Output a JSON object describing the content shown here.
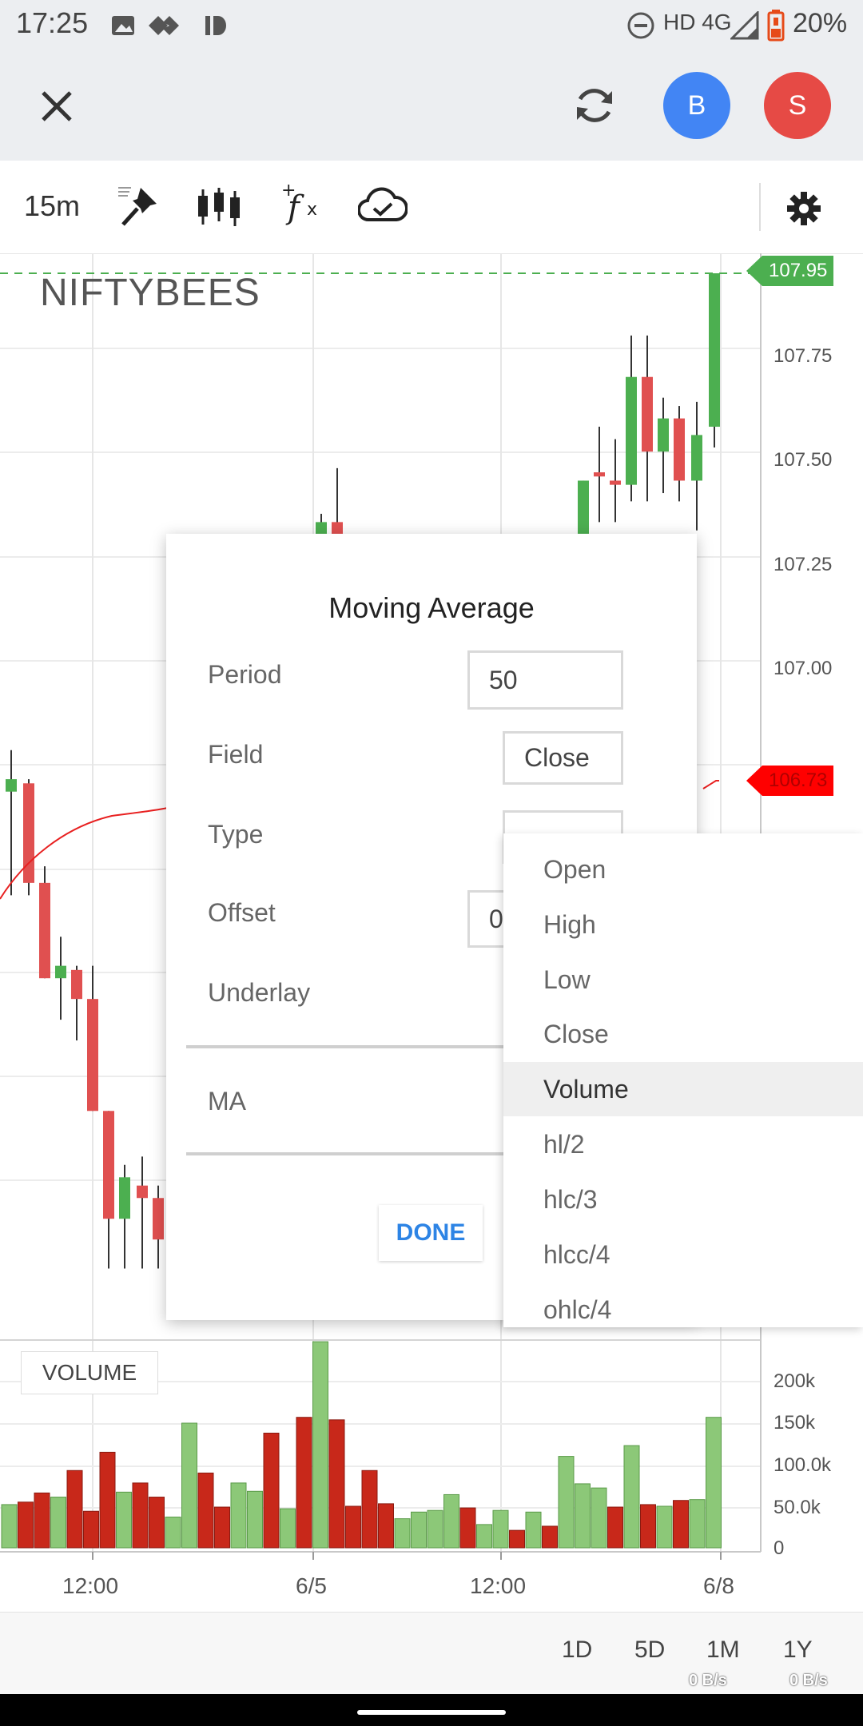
{
  "status_bar": {
    "time": "17:25",
    "network": "HD 4G",
    "battery": "20%"
  },
  "header": {
    "avatar_b": "B",
    "avatar_s": "S",
    "avatar_b_color": "#4285f4",
    "avatar_s_color": "#e64a45"
  },
  "toolbar": {
    "interval": "15m"
  },
  "chart": {
    "symbol": "NIFTYBEES",
    "current_price_tag": "107.95",
    "ma_price_tag": "106.73",
    "volume_label": "VOLUME",
    "price_ticks": [
      "107.75",
      "107.50",
      "107.25",
      "107.00"
    ],
    "volume_ticks": [
      "200k",
      "150k",
      "100.0k",
      "50.0k",
      "0"
    ],
    "x_ticks": [
      "12:00",
      "6/5",
      "12:00",
      "6/8"
    ],
    "colors": {
      "up": "#4caf50",
      "down": "#e05050",
      "vol_up": "#8cc878",
      "vol_down": "#c8281a"
    }
  },
  "chart_data": {
    "type": "candlestick",
    "title": "NIFTYBEES",
    "price_range": [
      106.2,
      108.0
    ],
    "price_candles": [
      {
        "o": 106.7,
        "h": 106.8,
        "l": 106.45,
        "c": 106.73
      },
      {
        "o": 106.72,
        "h": 106.73,
        "l": 106.45,
        "c": 106.48
      },
      {
        "o": 106.48,
        "h": 106.52,
        "l": 106.25,
        "c": 106.25
      },
      {
        "o": 106.25,
        "h": 106.35,
        "l": 106.15,
        "c": 106.28
      },
      {
        "o": 106.27,
        "h": 106.28,
        "l": 106.1,
        "c": 106.2
      },
      {
        "o": 106.2,
        "h": 106.28,
        "l": 105.93,
        "c": 105.93
      },
      {
        "o": 105.93,
        "h": 105.93,
        "l": 105.55,
        "c": 105.67
      },
      {
        "o": 105.67,
        "h": 105.8,
        "l": 105.55,
        "c": 105.77
      },
      {
        "o": 105.75,
        "h": 105.82,
        "l": 105.55,
        "c": 105.72
      },
      {
        "o": 105.72,
        "h": 105.75,
        "l": 105.55,
        "c": 105.62
      },
      {
        "o": 107.25,
        "h": 107.37,
        "l": 107.2,
        "c": 107.35
      },
      {
        "o": 107.35,
        "h": 107.48,
        "l": 107.2,
        "c": 107.3
      },
      {
        "o": 107.28,
        "h": 107.3,
        "l": 107.2,
        "c": 107.27
      },
      {
        "o": 107.27,
        "h": 107.3,
        "l": 107.2,
        "c": 107.25
      },
      {
        "o": 107.25,
        "h": 107.45,
        "l": 107.22,
        "c": 107.45
      },
      {
        "o": 107.47,
        "h": 107.58,
        "l": 107.35,
        "c": 107.46
      },
      {
        "o": 107.45,
        "h": 107.55,
        "l": 107.35,
        "c": 107.44
      },
      {
        "o": 107.44,
        "h": 107.8,
        "l": 107.4,
        "c": 107.7
      },
      {
        "o": 107.7,
        "h": 107.8,
        "l": 107.4,
        "c": 107.52
      },
      {
        "o": 107.52,
        "h": 107.65,
        "l": 107.42,
        "c": 107.6
      },
      {
        "o": 107.6,
        "h": 107.63,
        "l": 107.4,
        "c": 107.45
      },
      {
        "o": 107.45,
        "h": 107.64,
        "l": 107.33,
        "c": 107.56
      },
      {
        "o": 107.58,
        "h": 107.95,
        "l": 107.53,
        "c": 107.95
      }
    ],
    "volume_range": [
      0,
      200000
    ],
    "volumes": [
      {
        "v": 52000,
        "up": true
      },
      {
        "v": 55000,
        "up": false
      },
      {
        "v": 66000,
        "up": false
      },
      {
        "v": 61000,
        "up": true
      },
      {
        "v": 93000,
        "up": false
      },
      {
        "v": 44000,
        "up": false
      },
      {
        "v": 115000,
        "up": false
      },
      {
        "v": 67000,
        "up": true
      },
      {
        "v": 78000,
        "up": false
      },
      {
        "v": 61000,
        "up": false
      },
      {
        "v": 37000,
        "up": true
      },
      {
        "v": 150000,
        "up": true
      },
      {
        "v": 90000,
        "up": false
      },
      {
        "v": 49000,
        "up": false
      },
      {
        "v": 78000,
        "up": true
      },
      {
        "v": 68000,
        "up": true
      },
      {
        "v": 138000,
        "up": false
      },
      {
        "v": 47000,
        "up": true
      },
      {
        "v": 157000,
        "up": false
      },
      {
        "v": 248000,
        "up": true
      },
      {
        "v": 154000,
        "up": false
      },
      {
        "v": 50000,
        "up": false
      },
      {
        "v": 93000,
        "up": false
      },
      {
        "v": 53000,
        "up": false
      },
      {
        "v": 35000,
        "up": true
      },
      {
        "v": 43000,
        "up": true
      },
      {
        "v": 45000,
        "up": true
      },
      {
        "v": 64000,
        "up": true
      },
      {
        "v": 48000,
        "up": false
      },
      {
        "v": 28000,
        "up": true
      },
      {
        "v": 45000,
        "up": true
      },
      {
        "v": 21000,
        "up": false
      },
      {
        "v": 43000,
        "up": true
      },
      {
        "v": 26000,
        "up": false
      },
      {
        "v": 110000,
        "up": true
      },
      {
        "v": 77000,
        "up": true
      },
      {
        "v": 72000,
        "up": true
      },
      {
        "v": 49000,
        "up": false
      },
      {
        "v": 123000,
        "up": true
      },
      {
        "v": 52000,
        "up": false
      },
      {
        "v": 50000,
        "up": true
      },
      {
        "v": 57000,
        "up": false
      },
      {
        "v": 58000,
        "up": true
      },
      {
        "v": 157000,
        "up": true
      }
    ],
    "x_labels": [
      "12:00",
      "6/5",
      "12:00",
      "6/8"
    ]
  },
  "dialog": {
    "title": "Moving Average",
    "period_label": "Period",
    "period_value": "50",
    "field_label": "Field",
    "field_value": "Close",
    "type_label": "Type",
    "offset_label": "Offset",
    "offset_value": "0",
    "underlay_label": "Underlay",
    "ma_label": "MA",
    "done_label": "DONE"
  },
  "dropdown": {
    "options": [
      "Open",
      "High",
      "Low",
      "Close",
      "Volume",
      "hl/2",
      "hlc/3",
      "hlcc/4",
      "ohlc/4"
    ],
    "selected": "Volume"
  },
  "periods": [
    "1D",
    "5D",
    "1M",
    "1Y"
  ],
  "netspeed": [
    "0 B/s",
    "0 B/s"
  ]
}
